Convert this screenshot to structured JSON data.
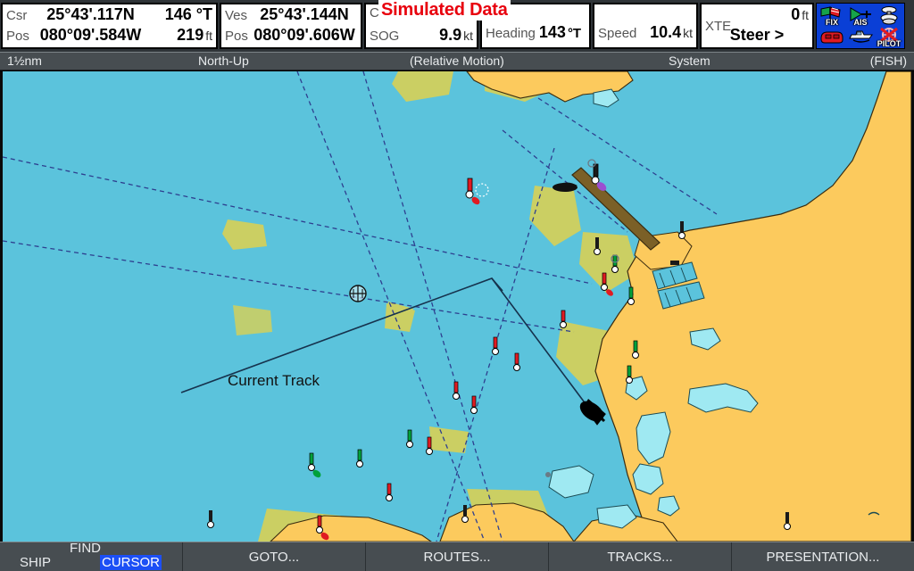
{
  "header": {
    "simulated_banner": "Simulated Data",
    "cursor_box": {
      "label_top": "Csr",
      "label_bottom": "Pos",
      "lat": "25°43'.117N",
      "lon": "080°09'.584W",
      "bearing": "146 °T",
      "range": "219",
      "range_unit": "ft"
    },
    "vessel_box": {
      "label_top": "Ves",
      "label_bottom": "Pos",
      "lat": "25°43'.144N",
      "lon": "080°09'.606W"
    },
    "cog_box": {
      "cog_label": "COG",
      "sog_label": "SOG",
      "sog_value": "9.9",
      "sog_unit": "kt"
    },
    "heading_box": {
      "label": "Heading",
      "value": "143",
      "unit": "°T"
    },
    "speed_box": {
      "label": "Speed",
      "value": "10.4",
      "unit": "kt"
    },
    "xte_box": {
      "label": "XTE",
      "value": "0",
      "unit": "ft",
      "steer": "Steer >"
    },
    "status_icons": [
      {
        "name": "fix-icon",
        "label": "FIX"
      },
      {
        "name": "ais-icon",
        "label": "AIS"
      },
      {
        "name": "radar-icon",
        "label": ""
      },
      {
        "name": "chart-card-icon",
        "label": ""
      },
      {
        "name": "vessel-icon",
        "label": ""
      },
      {
        "name": "pilot-icon",
        "label": "PILOT"
      }
    ]
  },
  "info_strip": {
    "range": "1½nm",
    "orientation": "North-Up",
    "motion_mode": "(Relative Motion)",
    "source": "System",
    "mode": "(FISH)"
  },
  "chart": {
    "track_label": "Current Track",
    "colors": {
      "sea": "#5bc3dc",
      "land": "#fcca5d",
      "intertidal": "#cbcf63",
      "lake": "#9fe9f2",
      "causeway": "#7b6027",
      "route_line": "#2e3f8f",
      "track_line": "#16324d",
      "vessel": "#000000",
      "buoy_green": "#00a13a",
      "buoy_red": "#e01b22"
    }
  },
  "softkeys": {
    "find": {
      "title": "FIND",
      "ship": "SHIP",
      "cursor": "CURSOR"
    },
    "goto": "GOTO...",
    "routes": "ROUTES...",
    "tracks": "TRACKS...",
    "presentation": "PRESENTATION..."
  }
}
